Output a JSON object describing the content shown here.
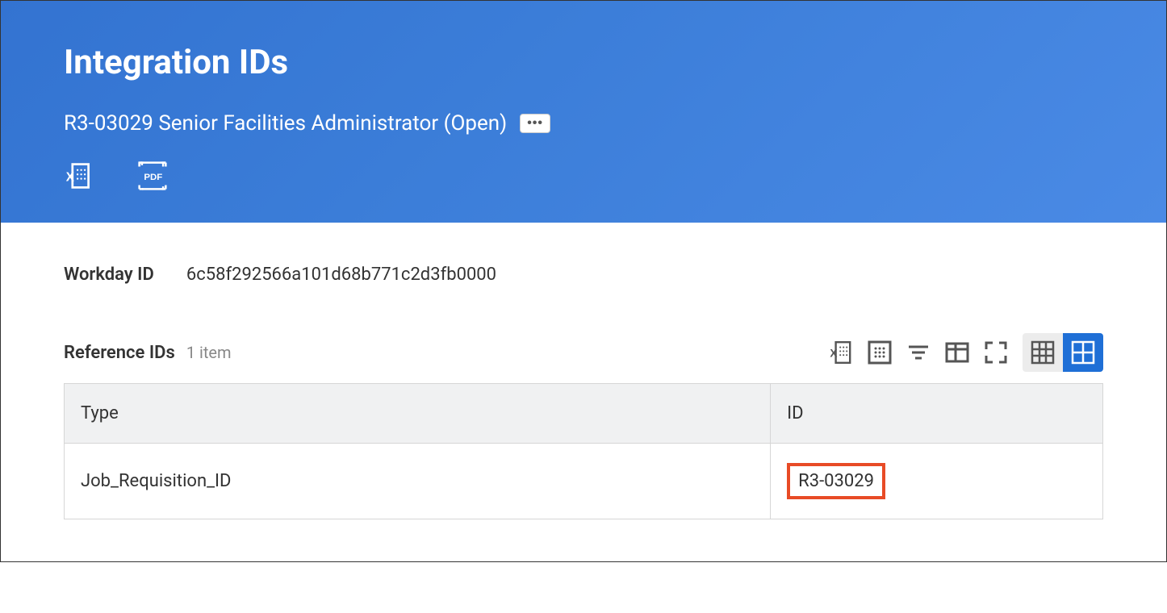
{
  "header": {
    "title": "Integration IDs",
    "subtitle": "R3-03029 Senior Facilities Administrator (Open)"
  },
  "workday_id": {
    "label": "Workday ID",
    "value": "6c58f292566a101d68b771c2d3fb0000"
  },
  "reference_ids": {
    "title": "Reference IDs",
    "count": "1 item",
    "columns": {
      "type": "Type",
      "id": "ID"
    },
    "rows": [
      {
        "type": "Job_Requisition_ID",
        "id": "R3-03029"
      }
    ]
  }
}
